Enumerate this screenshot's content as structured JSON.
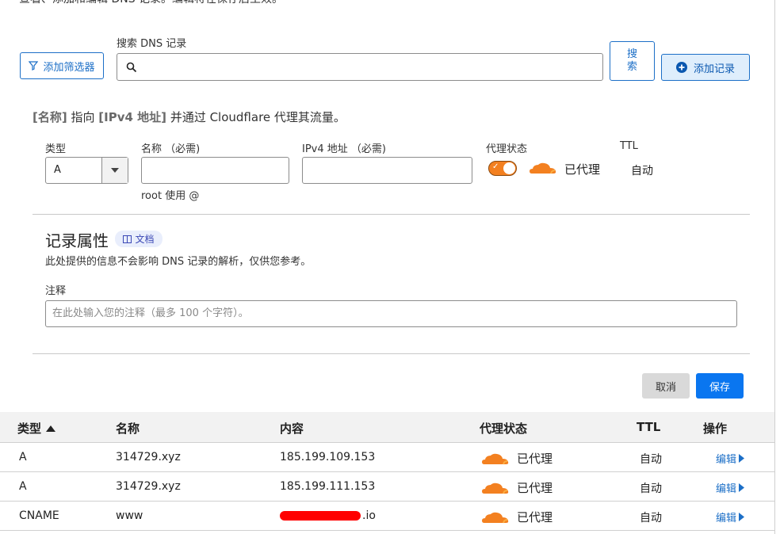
{
  "top_text": "查看、添加和编辑 DNS 记录。编辑将在保存后生效。",
  "toolbar": {
    "filter_label": "添加筛选器",
    "search_label": "搜索 DNS 记录",
    "search_placeholder": "",
    "search_button": "搜索",
    "add_record": "添加记录"
  },
  "form": {
    "description_name": "[名称]",
    "description_mid": "指向",
    "description_ip": "[IPv4 地址]",
    "description_tail": "并通过 Cloudflare 代理其流量。",
    "type_label": "类型",
    "type_value": "A",
    "name_label": "名称 （必需)",
    "name_hint": "root 使用 @",
    "ip_label": "IPv4 地址 （必需)",
    "proxy_label": "代理状态",
    "proxy_value": "已代理",
    "ttl_label": "TTL",
    "ttl_value": "自动"
  },
  "attributes": {
    "title": "记录属性",
    "doc_badge": "文档",
    "subtitle": "此处提供的信息不会影响 DNS 记录的解析，仅供您参考。",
    "note_label": "注释",
    "note_placeholder": "在此处输入您的注释（最多 100 个字符）。"
  },
  "actions": {
    "cancel": "取消",
    "save": "保存"
  },
  "table": {
    "headers": {
      "type": "类型",
      "name": "名称",
      "content": "内容",
      "proxy": "代理状态",
      "ttl": "TTL",
      "actions": "操作"
    },
    "rows": [
      {
        "type": "A",
        "name": "314729.xyz",
        "content": "185.199.109.153",
        "proxy": "已代理",
        "ttl": "自动",
        "action": "编辑"
      },
      {
        "type": "A",
        "name": "314729.xyz",
        "content": "185.199.111.153",
        "proxy": "已代理",
        "ttl": "自动",
        "action": "编辑"
      },
      {
        "type": "CNAME",
        "name": "www",
        "content": ".io",
        "proxy": "已代理",
        "ttl": "自动",
        "action": "编辑"
      }
    ]
  },
  "colors": {
    "accent": "#1c6fc7",
    "proxy_orange": "#f38020",
    "save_blue": "#0a76f0"
  }
}
